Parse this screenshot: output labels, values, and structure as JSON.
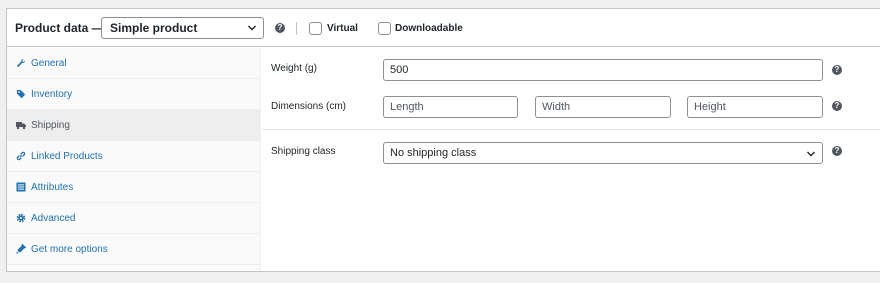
{
  "header": {
    "title": "Product data —",
    "product_type": "Simple product",
    "help_glyph": "?",
    "virtual_label": "Virtual",
    "downloadable_label": "Downloadable"
  },
  "tabs": [
    {
      "label": "General",
      "icon": "wrench-icon",
      "active": false
    },
    {
      "label": "Inventory",
      "icon": "tag-icon",
      "active": false
    },
    {
      "label": "Shipping",
      "icon": "truck-icon",
      "active": true
    },
    {
      "label": "Linked Products",
      "icon": "link-icon",
      "active": false
    },
    {
      "label": "Attributes",
      "icon": "list-icon",
      "active": false
    },
    {
      "label": "Advanced",
      "icon": "gear-icon",
      "active": false
    },
    {
      "label": "Get more options",
      "icon": "plugin-icon",
      "active": false
    }
  ],
  "shipping": {
    "weight_label": "Weight (g)",
    "weight_value": "500",
    "dimensions_label": "Dimensions (cm)",
    "length_placeholder": "Length",
    "width_placeholder": "Width",
    "height_placeholder": "Height",
    "class_label": "Shipping class",
    "class_value": "No shipping class"
  },
  "colors": {
    "link": "#2271b1",
    "active_tab_bg": "#eeeeee",
    "border": "#c3c4c7",
    "help_icon": "#50575e"
  }
}
